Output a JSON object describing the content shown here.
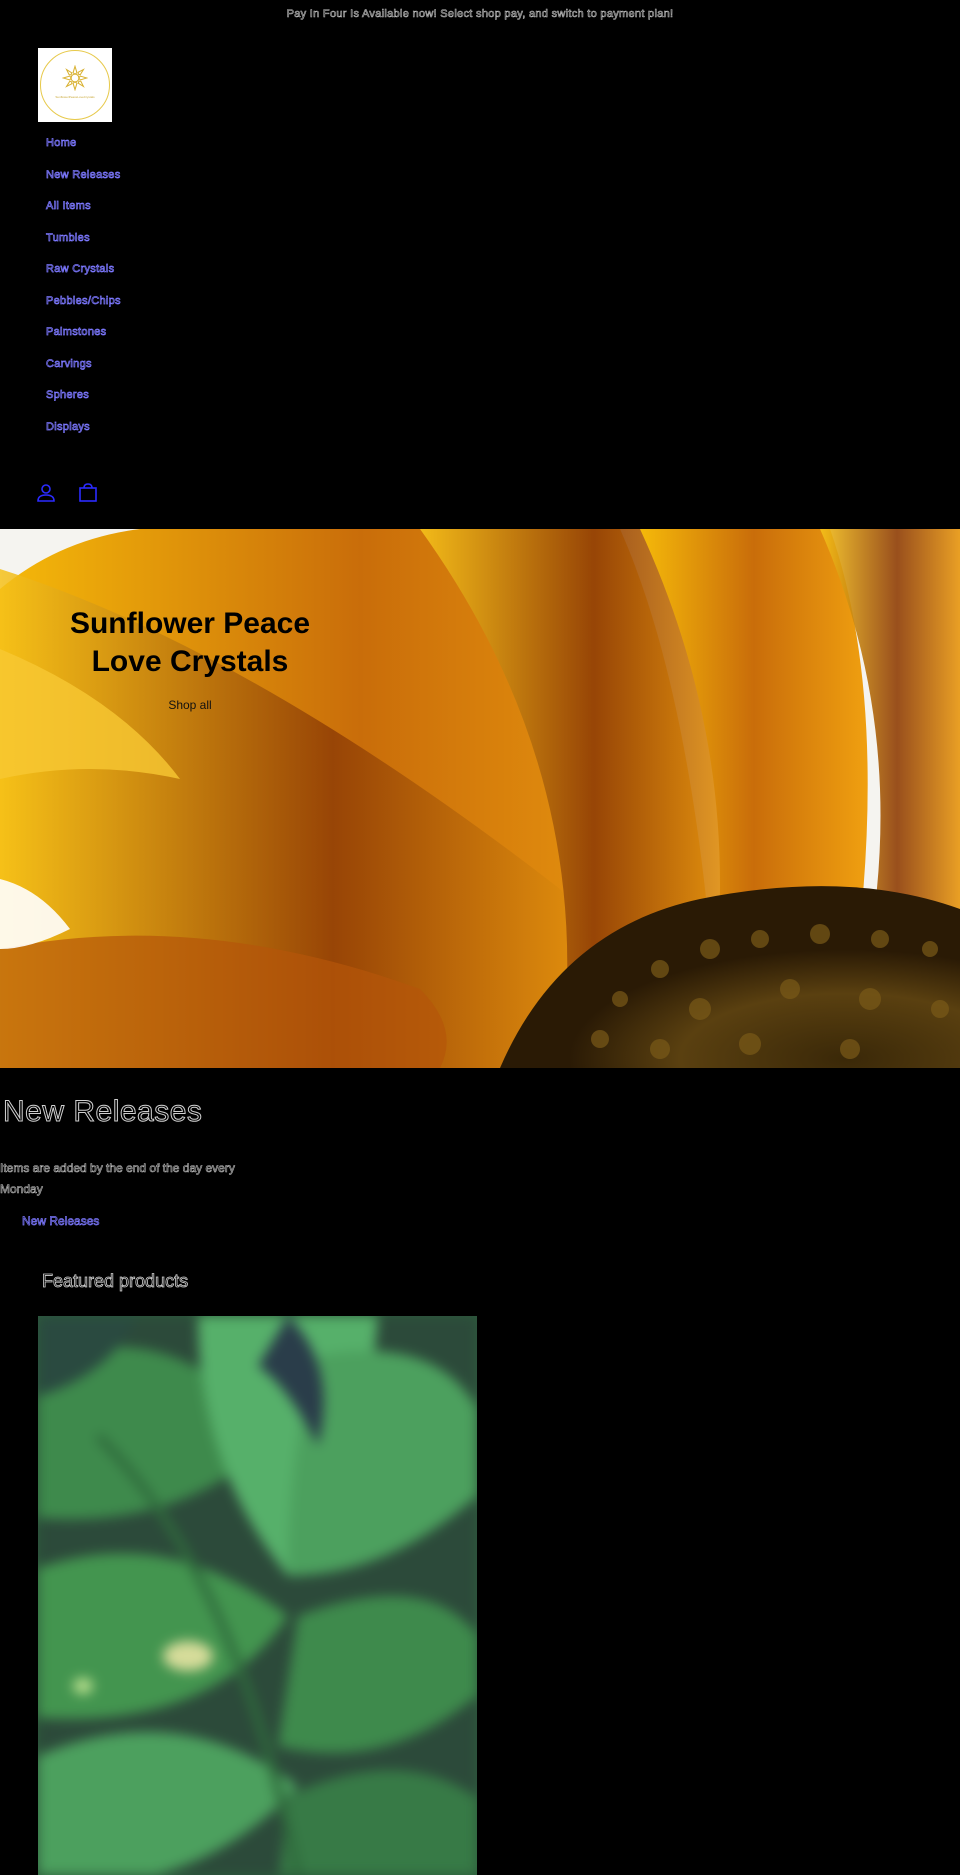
{
  "announcement": "Pay In Four Is Available now! Select shop pay, and switch to payment plan!",
  "logo": {
    "text": "SunflowerPeaceLoveCrystals"
  },
  "nav": {
    "items": [
      "Home",
      "New Releases",
      "All Items",
      "Tumbles",
      "Raw Crystals",
      "Pebbles/Chips",
      "Palmstones",
      "Carvings",
      "Spheres",
      "Displays"
    ]
  },
  "header": {
    "account_icon": "account-icon",
    "cart_icon": "cart-icon"
  },
  "hero": {
    "title": "Sunflower Peace Love Crystals",
    "button": "Shop all"
  },
  "collection": {
    "title": "New Releases",
    "description": "Items are added by the end of the day every Monday",
    "link": "New Releases"
  },
  "featured": {
    "title": "Featured products"
  },
  "colors": {
    "background": "#000000",
    "link": "#7c78ff",
    "petal": "#e39a12"
  }
}
